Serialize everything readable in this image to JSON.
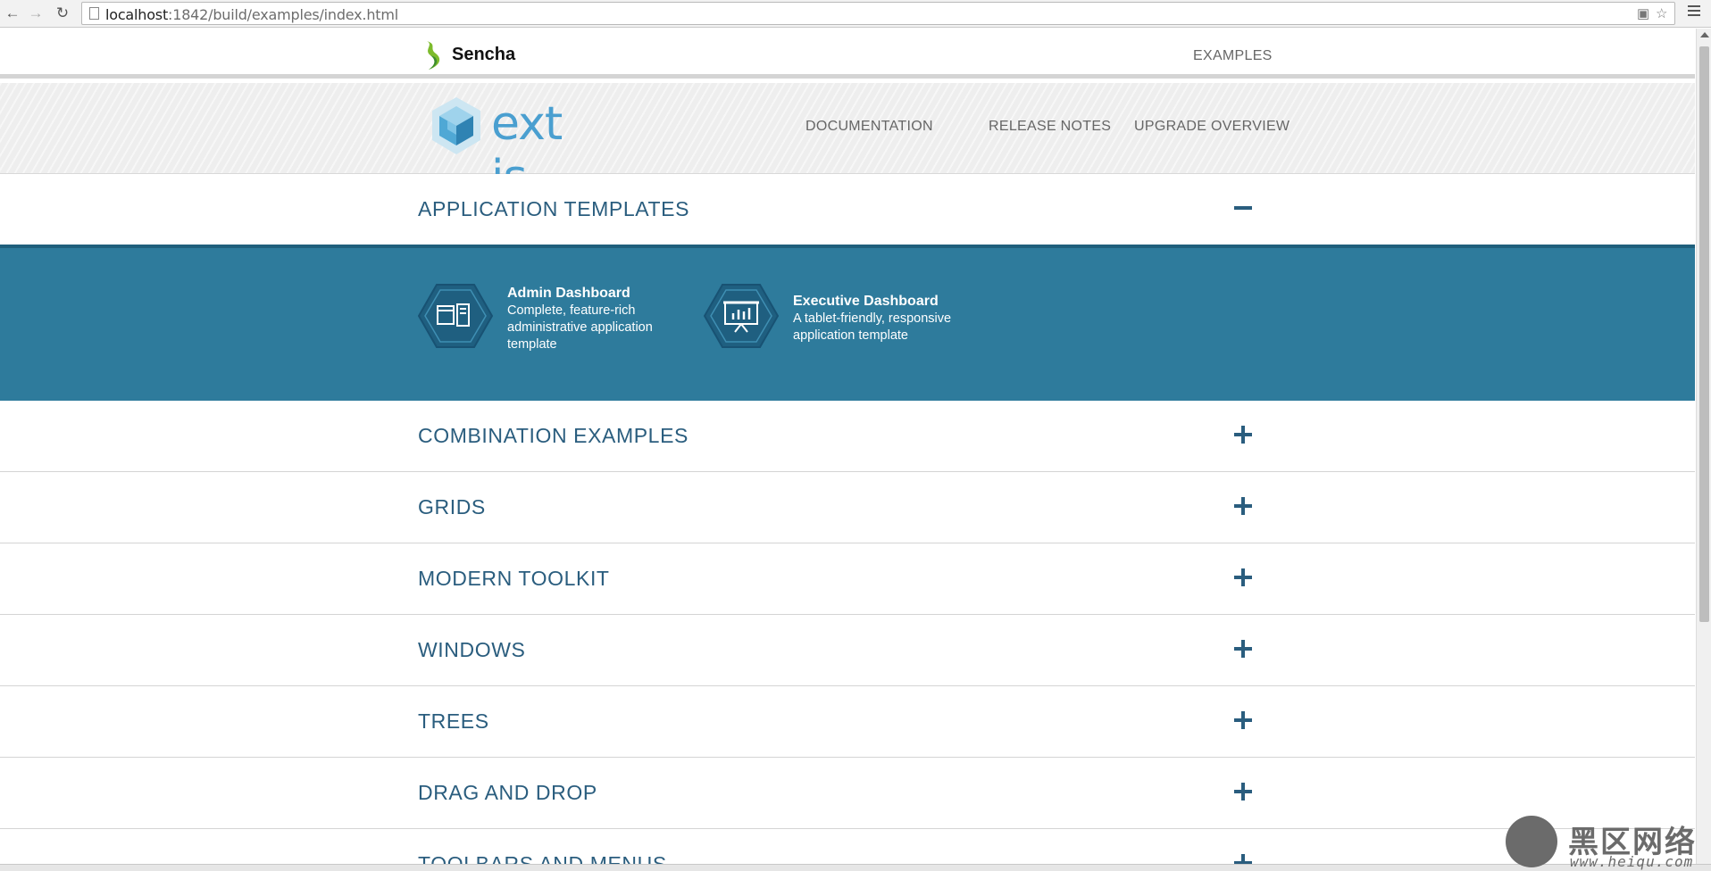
{
  "browser": {
    "url_host": "localhost",
    "url_rest": ":1842/build/examples/index.html",
    "back_icon": "back-arrow-icon",
    "forward_icon": "forward-arrow-icon",
    "reload_icon": "reload-icon"
  },
  "header": {
    "brand": "Sencha",
    "examples_link": "EXAMPLES"
  },
  "ext_header": {
    "logo_text": "ext js",
    "links": [
      "DOCUMENTATION",
      "RELEASE NOTES",
      "UPGRADE OVERVIEW"
    ]
  },
  "sections": [
    {
      "title": "APPLICATION TEMPLATES",
      "expanded": true
    },
    {
      "title": "COMBINATION EXAMPLES",
      "expanded": false
    },
    {
      "title": "GRIDS",
      "expanded": false
    },
    {
      "title": "MODERN TOOLKIT",
      "expanded": false
    },
    {
      "title": "WINDOWS",
      "expanded": false
    },
    {
      "title": "TREES",
      "expanded": false
    },
    {
      "title": "DRAG AND DROP",
      "expanded": false
    },
    {
      "title": "TOOLBARS AND MENUS",
      "expanded": false
    }
  ],
  "templates": [
    {
      "title": "Admin Dashboard",
      "description": "Complete, feature-rich administrative application template",
      "icon": "dashboard-layout-icon"
    },
    {
      "title": "Executive Dashboard",
      "description": "A tablet-friendly, responsive application template",
      "icon": "presentation-chart-icon"
    }
  ],
  "watermark": {
    "chinese": "黑区网络",
    "url": "www.heiqu.com"
  },
  "colors": {
    "accent": "#2a5d7e",
    "panel": "#2e7b9c",
    "ext_blue": "#4a9fd0"
  }
}
